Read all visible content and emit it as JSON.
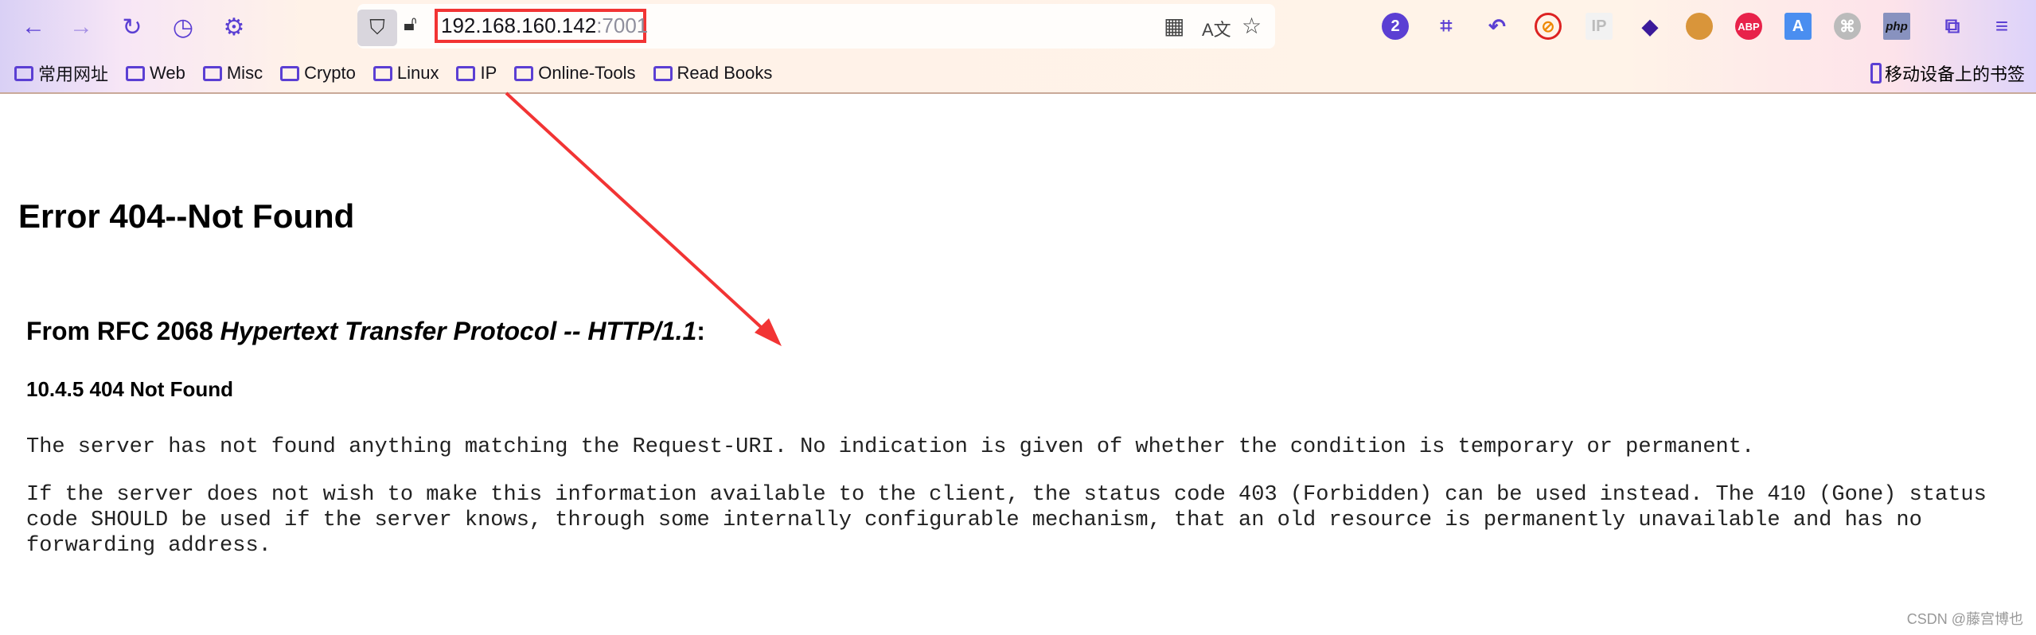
{
  "toolbar": {
    "url_host": "192.168.160.142",
    "url_port": ":7001",
    "ext_badge": "2",
    "ext_ip": "IP",
    "ext_abp": "ABP",
    "ext_php": "php"
  },
  "bookmarks": [
    "常用网址",
    "Web",
    "Misc",
    "Crypto",
    "Linux",
    "IP",
    "Online-Tools",
    "Read Books"
  ],
  "mobile_bookmarks": "移动设备上的书签",
  "page": {
    "h1": "Error 404--Not Found",
    "h2_prefix": "From RFC 2068 ",
    "h2_italic": "Hypertext Transfer Protocol -- HTTP/1.1",
    "h2_suffix": ":",
    "h3": "10.4.5 404 Not Found",
    "p1": "The server has not found anything matching the Request-URI. No indication is given of whether the condition is temporary or permanent.",
    "p2": "If the server does not wish to make this information available to the client, the status code 403 (Forbidden) can be used instead. The 410 (Gone) status code SHOULD be used if the server knows, through some internally configurable mechanism, that an old resource is permanently unavailable and has no forwarding address."
  },
  "watermark": "CSDN @藤宫博也",
  "colors": {
    "accent": "#5b3fd3",
    "annotation": "#f23434"
  }
}
